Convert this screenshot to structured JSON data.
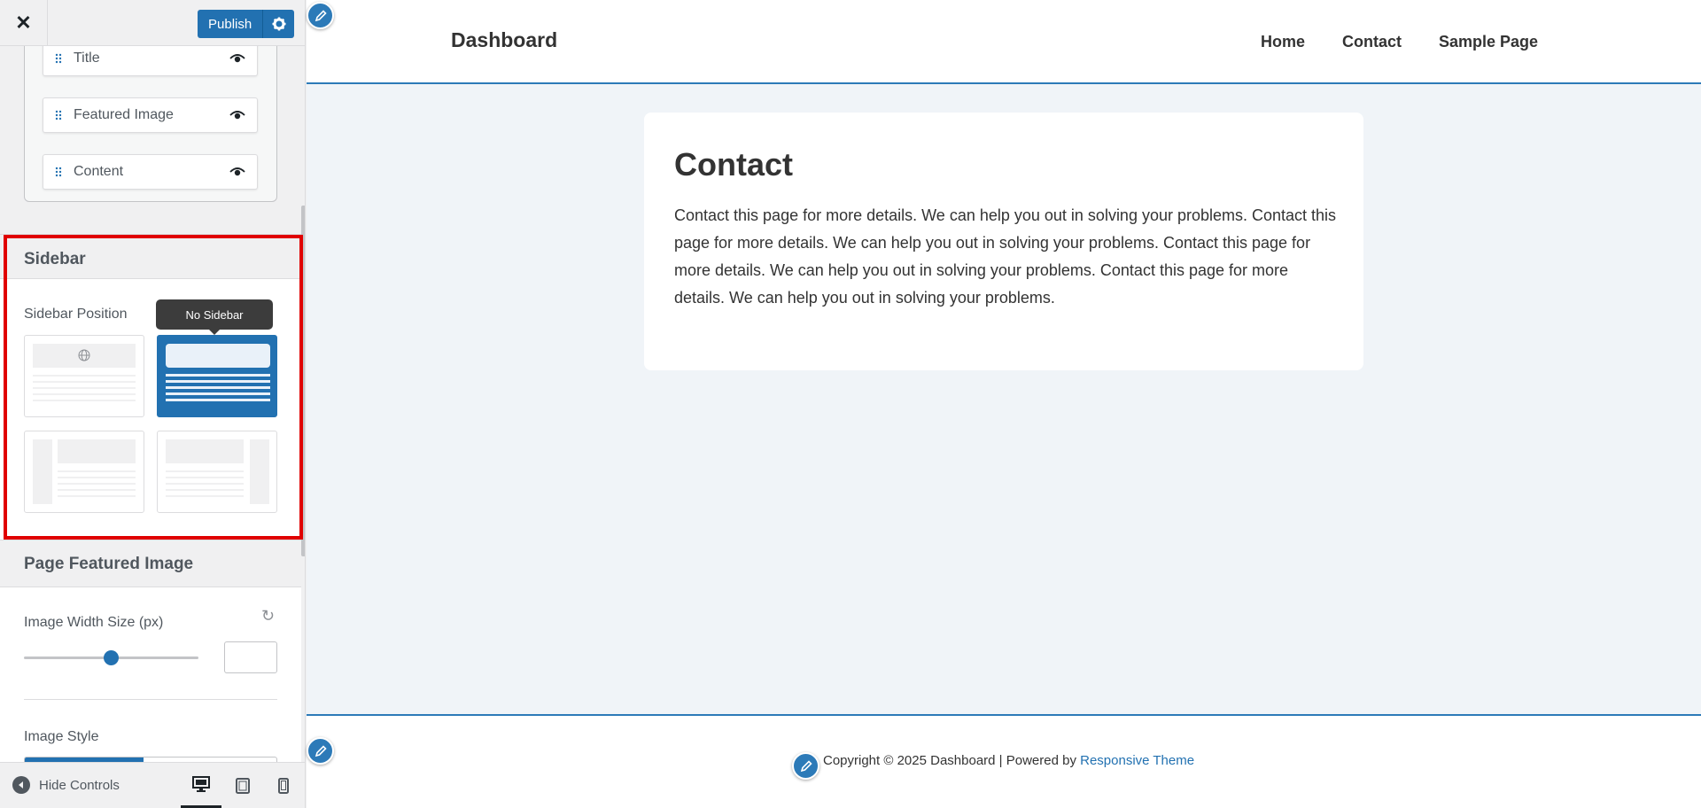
{
  "panel": {
    "close_label": "✕",
    "publish_label": "Publish",
    "meta_items": [
      {
        "label": "Title"
      },
      {
        "label": "Featured Image"
      },
      {
        "label": "Content"
      }
    ],
    "sidebar_section": {
      "heading": "Sidebar",
      "position_label": "Sidebar Position",
      "tooltip": "No Sidebar",
      "selected_option": "No Sidebar"
    },
    "featured_image_section": {
      "heading": "Page Featured Image",
      "width_label": "Image Width Size (px)",
      "width_value": "",
      "slider_fraction": 0.5,
      "style_label": "Image Style"
    },
    "footer": {
      "hide_controls_label": "Hide Controls",
      "devices": [
        "desktop-icon",
        "tablet-icon",
        "mobile-icon"
      ],
      "active_device": "desktop"
    }
  },
  "preview": {
    "site_title": "Dashboard",
    "nav": [
      "Home",
      "Contact",
      "Sample Page"
    ],
    "page_title": "Contact",
    "page_body": "Contact this page for more details. We can help you out in solving your problems. Contact this page for more details. We can help you out in solving your problems. Contact this page for more details. We can help you out in solving your problems. Contact this page for more details. We can help you out in solving your problems.",
    "footer_text": "Copyright © 2025 Dashboard | Powered by ",
    "footer_link": "Responsive Theme"
  },
  "colors": {
    "accent": "#2271b1",
    "highlight": "#e00000",
    "preview_bg": "#f0f4f8"
  }
}
